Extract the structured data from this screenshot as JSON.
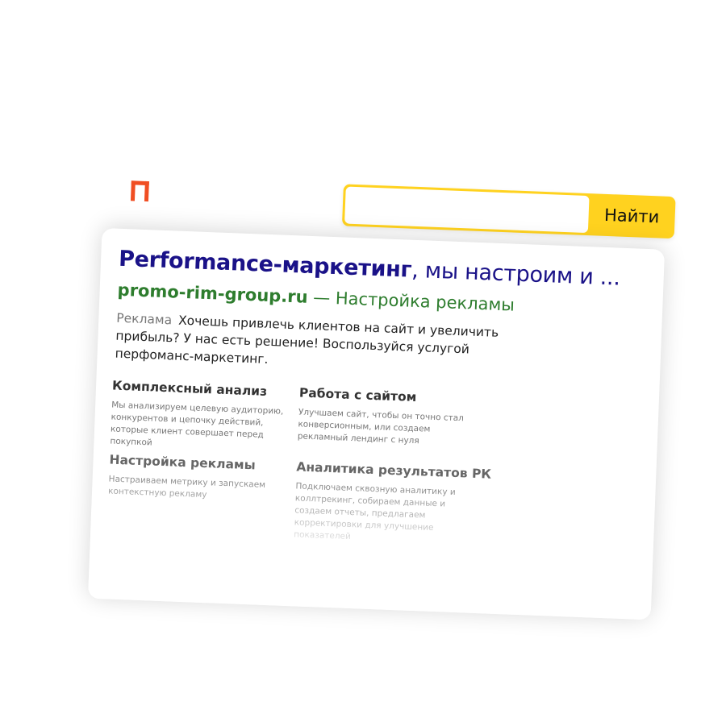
{
  "search": {
    "value": "",
    "button_label": "Найти"
  },
  "ad": {
    "title_bold": "Performance-маркетинг",
    "title_rest": ", мы настроим и ...",
    "domain": "promo-rim-group.ru",
    "url_rest": " — Настройка рекламы",
    "label": "Реклама",
    "description": "Хочешь привлечь клиентов на сайт и увеличить прибыль? У нас есть решение! Воспользуйся услугой перфоманс-маркетинг."
  },
  "sitelinks": [
    {
      "title": "Комплексный анализ",
      "text": "Мы анализируем целевую аудиторию, конкурентов и цепочку действий, которые клиент совершает перед покупкой"
    },
    {
      "title": "Работа с сайтом",
      "text": "Улучшаем сайт, чтобы он точно стал конверсионным, или создаем рекламный лендинг с нуля"
    },
    {
      "title": "Настройка рекламы",
      "text": "Настраиваем метрику и запускаем контекстную рекламу"
    },
    {
      "title": "Аналитика результатов РК",
      "text": "Подключаем сквозную аналитику и коллтрекинг, собираем данные и создаем отчеты, предлагаем корректировки для улучшение показателей"
    }
  ],
  "colors": {
    "logo": "#f04e23",
    "search_border": "#ffd21f",
    "title": "#1a1288",
    "url": "#2e7d2e"
  },
  "icons": {
    "logo": "yandex-logo-icon"
  }
}
